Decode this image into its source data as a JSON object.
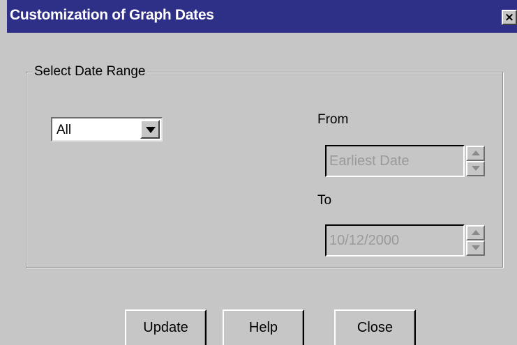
{
  "window": {
    "title": "Customization of Graph Dates",
    "close_label": "×"
  },
  "group": {
    "label": "Select Date Range"
  },
  "range_select": {
    "value": "All",
    "icon": "chevron-down-icon"
  },
  "from": {
    "label": "From",
    "value": "Earliest Date",
    "disabled": true
  },
  "to": {
    "label": "To",
    "value": "10/12/2000",
    "disabled": true
  },
  "buttons": {
    "update": "Update",
    "help": "Help",
    "close": "Close"
  },
  "colors": {
    "titlebar": "#2e2f86",
    "face": "#c6c6c6",
    "disabled_text": "#9a9a9a"
  }
}
